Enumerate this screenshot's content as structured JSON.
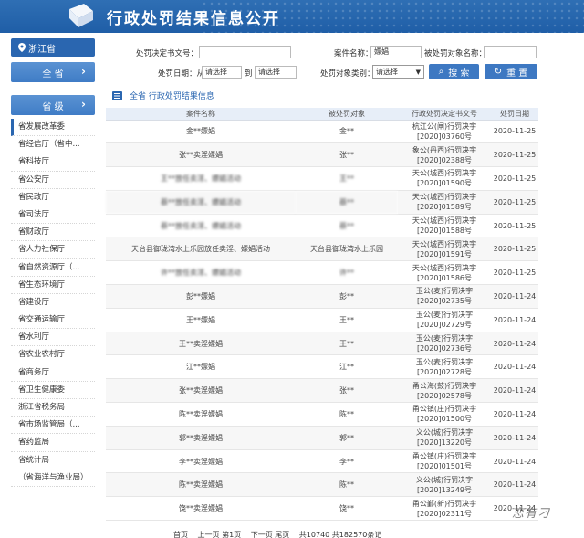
{
  "header": {
    "title": "行政处罚结果信息公开"
  },
  "sidebar": {
    "province": "浙江省",
    "all_label": "全 省",
    "level_label": "省 级",
    "items": [
      "省发展改革委",
      "省经信厅（省中...",
      "省科技厅",
      "省公安厅",
      "省民政厅",
      "省司法厅",
      "省财政厅",
      "省人力社保厅",
      "省自然资源厅（...",
      "省生态环境厅",
      "省建设厅",
      "省交通运输厅",
      "省水利厅",
      "省农业农村厅",
      "省商务厅",
      "省卫生健康委",
      "浙江省税务局",
      "省市场监管局（...",
      "省药监局",
      "省统计局",
      "（省海洋与渔业局）"
    ]
  },
  "filters": {
    "decision_no_label": "处罚决定书文号：",
    "decision_no_value": "",
    "case_name_label": "案件名称：",
    "case_name_value": "嫖娼",
    "target_name_label": "被处罚对象名称：",
    "target_name_value": "",
    "date_label": "处罚日期：从",
    "date_from": "请选择",
    "date_to_label": "到",
    "date_to": "请选择",
    "target_type_label": "处罚对象类别：",
    "target_type_value": "请选择",
    "search_label": "搜 索",
    "reset_label": "重 置"
  },
  "breadcrumb": "全省 行政处罚结果信息",
  "table": {
    "headers": [
      "案件名称",
      "被处罚对象",
      "行政处罚决定书文号",
      "处罚日期"
    ],
    "rows": [
      {
        "case": "金**嫖娼",
        "target": "金**",
        "doc": "杭江公(闸)行罚决字[2020]03760号",
        "date": "2020-11-25"
      },
      {
        "case": "张**卖淫嫖娼",
        "target": "张**",
        "doc": "象公(丹西)行罚决字[2020]02388号",
        "date": "2020-11-25"
      },
      {
        "case": "王**放任卖淫、嫖娼活动",
        "target": "王**",
        "doc": "天公(城西)行罚决字[2020]01590号",
        "date": "2020-11-25"
      },
      {
        "case": "蔡**放任卖淫、嫖娼活动",
        "target": "蔡**",
        "doc": "天公(城西)行罚决字[2020]01589号",
        "date": "2020-11-25"
      },
      {
        "case": "蔡**放任卖淫、嫖娼活动",
        "target": "蔡**",
        "doc": "天公(城西)行罚决字[2020]01588号",
        "date": "2020-11-25"
      },
      {
        "case": "天台县御珑湾水上乐园放任卖淫、嫖娼活动",
        "target": "天台县御珑湾水上乐园",
        "doc": "天公(城西)行罚决字[2020]01591号",
        "date": "2020-11-25"
      },
      {
        "case": "许**放任卖淫、嫖娼活动",
        "target": "许**",
        "doc": "天公(城西)行罚决字[2020]01586号",
        "date": "2020-11-25"
      },
      {
        "case": "彭**嫖娼",
        "target": "彭**",
        "doc": "玉公(麦)行罚决字[2020]02735号",
        "date": "2020-11-24"
      },
      {
        "case": "王**嫖娼",
        "target": "王**",
        "doc": "玉公(麦)行罚决字[2020]02729号",
        "date": "2020-11-24"
      },
      {
        "case": "王**卖淫嫖娼",
        "target": "王**",
        "doc": "玉公(麦)行罚决字[2020]02736号",
        "date": "2020-11-24"
      },
      {
        "case": "江**嫖娼",
        "target": "江**",
        "doc": "玉公(麦)行罚决字[2020]02728号",
        "date": "2020-11-24"
      },
      {
        "case": "张**卖淫嫖娼",
        "target": "张**",
        "doc": "甬公海(鼓)行罚决字[2020]02578号",
        "date": "2020-11-24"
      },
      {
        "case": "陈**卖淫嫖娼",
        "target": "陈**",
        "doc": "甬公镇(庄)行罚决字[2020]01500号",
        "date": "2020-11-24"
      },
      {
        "case": "郭**卖淫嫖娼",
        "target": "郭**",
        "doc": "义公(城)行罚决字[2020]13220号",
        "date": "2020-11-24"
      },
      {
        "case": "李**卖淫嫖娼",
        "target": "李**",
        "doc": "甬公镇(庄)行罚决字[2020]01501号",
        "date": "2020-11-24"
      },
      {
        "case": "陈**卖淫嫖娼",
        "target": "陈**",
        "doc": "义公(城)行罚决字[2020]13249号",
        "date": "2020-11-24"
      },
      {
        "case": "饶**卖淫嫖娼",
        "target": "饶**",
        "doc": "甬公鄞(新)行罚决字[2020]02311号",
        "date": "2020-11-24"
      }
    ]
  },
  "pager": {
    "text": "首页　 上一页 第1页　 下一页 尾页　 共10740 共182570条记"
  },
  "watermark": "恋有刁",
  "colors": {
    "accent": "#2a66b0",
    "banner": "#1f5ea7",
    "table_header": "#e7eef8"
  }
}
